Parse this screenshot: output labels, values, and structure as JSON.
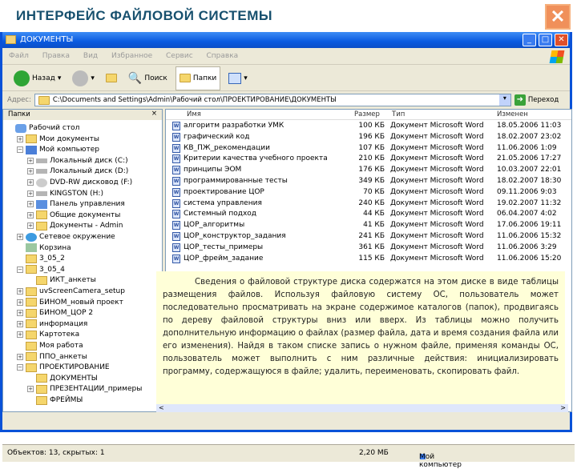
{
  "slide": {
    "title": "ИНТЕРФЕЙС ФАЙЛОВОЙ СИСТЕМЫ",
    "close": "✕"
  },
  "window": {
    "title": "ДОКУМЕНТЫ",
    "menu": [
      "Файл",
      "Правка",
      "Вид",
      "Избранное",
      "Сервис",
      "Справка"
    ],
    "toolbar": {
      "back": "Назад",
      "search": "Поиск",
      "folders": "Папки"
    },
    "address": {
      "label": "Адрес:",
      "value": "C:\\Documents and Settings\\Admin\\Рабочий стол\\ПРОЕКТИРОВАНИЕ\\ДОКУМЕНТЫ",
      "go": "Переход"
    },
    "tree_header": "Папки",
    "tree_close": "×",
    "tree": [
      {
        "label": "Рабочий стол",
        "level": 0,
        "exp": "",
        "icon": "desktop"
      },
      {
        "label": "Мои документы",
        "level": 1,
        "exp": "+",
        "icon": "folder"
      },
      {
        "label": "Мой компьютер",
        "level": 1,
        "exp": "−",
        "icon": "computer"
      },
      {
        "label": "Локальный диск (C:)",
        "level": 2,
        "exp": "+",
        "icon": "drive"
      },
      {
        "label": "Локальный диск (D:)",
        "level": 2,
        "exp": "+",
        "icon": "drive"
      },
      {
        "label": "DVD-RW дисковод (F:)",
        "level": 2,
        "exp": "+",
        "icon": "dvd"
      },
      {
        "label": "KINGSTON (H:)",
        "level": 2,
        "exp": "+",
        "icon": "drive"
      },
      {
        "label": "Панель управления",
        "level": 2,
        "exp": "+",
        "icon": "control"
      },
      {
        "label": "Общие документы",
        "level": 2,
        "exp": "+",
        "icon": "folder"
      },
      {
        "label": "Документы - Admin",
        "level": 2,
        "exp": "+",
        "icon": "folder"
      },
      {
        "label": "Сетевое окружение",
        "level": 1,
        "exp": "+",
        "icon": "network"
      },
      {
        "label": "Корзина",
        "level": 1,
        "exp": "",
        "icon": "recycle"
      },
      {
        "label": "3_05_2",
        "level": 1,
        "exp": "",
        "icon": "folder"
      },
      {
        "label": "3_05_4",
        "level": 1,
        "exp": "−",
        "icon": "folder"
      },
      {
        "label": "ИКТ_анкеты",
        "level": 2,
        "exp": "",
        "icon": "folder"
      },
      {
        "label": "uvScreenCamera_setup",
        "level": 1,
        "exp": "+",
        "icon": "folder"
      },
      {
        "label": "БИНОМ_новый проект",
        "level": 1,
        "exp": "+",
        "icon": "folder"
      },
      {
        "label": "БИНОМ_ЦОР 2",
        "level": 1,
        "exp": "+",
        "icon": "folder"
      },
      {
        "label": "информация",
        "level": 1,
        "exp": "+",
        "icon": "folder"
      },
      {
        "label": "Картотека",
        "level": 1,
        "exp": "+",
        "icon": "folder"
      },
      {
        "label": "Моя работа",
        "level": 1,
        "exp": "",
        "icon": "folder"
      },
      {
        "label": "ППО_анкеты",
        "level": 1,
        "exp": "+",
        "icon": "folder"
      },
      {
        "label": "ПРОЕКТИРОВАНИЕ",
        "level": 1,
        "exp": "−",
        "icon": "folder"
      },
      {
        "label": "ДОКУМЕНТЫ",
        "level": 2,
        "exp": "",
        "icon": "folder"
      },
      {
        "label": "ПРЕЗЕНТАЦИИ_примеры",
        "level": 2,
        "exp": "+",
        "icon": "folder"
      },
      {
        "label": "ФРЕЙМЫ",
        "level": 2,
        "exp": "",
        "icon": "folder"
      }
    ],
    "columns": {
      "name": "Имя",
      "size": "Размер",
      "type": "Тип",
      "modified": "Изменен"
    },
    "files": [
      {
        "name": "алгоритм разработки УМК",
        "size": "100 КБ",
        "type": "Документ Microsoft Word",
        "date": "18.05.2006 11:03"
      },
      {
        "name": "графический код",
        "size": "196 КБ",
        "type": "Документ Microsoft Word",
        "date": "18.02.2007 23:02"
      },
      {
        "name": "КВ_ПЖ_рекомендации",
        "size": "107 КБ",
        "type": "Документ Microsoft Word",
        "date": "11.06.2006 1:09"
      },
      {
        "name": "Критерии качества учебного проекта",
        "size": "210 КБ",
        "type": "Документ Microsoft Word",
        "date": "21.05.2006 17:27"
      },
      {
        "name": "принципы ЭОМ",
        "size": "176 КБ",
        "type": "Документ Microsoft Word",
        "date": "10.03.2007 22:01"
      },
      {
        "name": "программированные тесты",
        "size": "349 КБ",
        "type": "Документ Microsoft Word",
        "date": "18.02.2007 18:30"
      },
      {
        "name": "проектирование ЦОР",
        "size": "70 КБ",
        "type": "Документ Microsoft Word",
        "date": "09.11.2006 9:03"
      },
      {
        "name": "система управления",
        "size": "240 КБ",
        "type": "Документ Microsoft Word",
        "date": "19.02.2007 11:32"
      },
      {
        "name": "Системный подход",
        "size": "44 КБ",
        "type": "Документ Microsoft Word",
        "date": "06.04.2007 4:02"
      },
      {
        "name": "ЦОР_алгоритмы",
        "size": "41 КБ",
        "type": "Документ Microsoft Word",
        "date": "17.06.2006 19:11"
      },
      {
        "name": "ЦОР_конструктор_задания",
        "size": "241 КБ",
        "type": "Документ Microsoft Word",
        "date": "11.06.2006 15:32"
      },
      {
        "name": "ЦОР_тесты_примеры",
        "size": "361 КБ",
        "type": "Документ Microsoft Word",
        "date": "11.06.2006 3:29"
      },
      {
        "name": "ЦОР_фрейм_задание",
        "size": "115 КБ",
        "type": "Документ Microsoft Word",
        "date": "11.06.2006 15:20"
      }
    ],
    "status": {
      "objects": "Объектов: 13, скрытых: 1",
      "size": "2,20 МБ",
      "location": "Мой компьютер"
    }
  },
  "note": "Сведения о файловой структуре диска содержатся на этом диске в виде таблицы размещения файлов. Используя файловую систему ОС, пользователь может последовательно просматривать на экране содержимое каталогов (папок), продвигаясь по дереву файловой структуры вниз или вверх. Из таблицы можно получить дополнительную информацию о файлах (размер файла, дата и время создания файла или его изменения). Найдя в таком списке запись о нужном файле, применяя команды ОС, пользователь может выполнить с ним различные действия: инициализировать программу, содержащуюся в файле; удалить, переименовать, скопировать файл.",
  "colors": {
    "title": "#17506e",
    "titlebar": "#0a5ae0",
    "note_bg": "#ffffd8",
    "close": "#f0905a"
  }
}
